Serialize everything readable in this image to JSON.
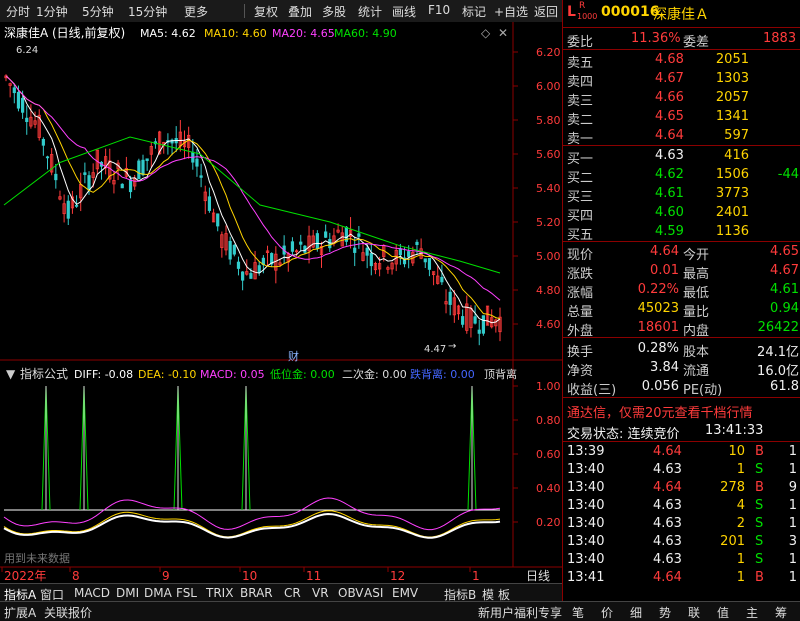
{
  "toolbar": {
    "items": [
      "分时",
      "1分钟",
      "5分钟",
      "15分钟",
      "更多",
      "复权",
      "叠加",
      "多股",
      "统计",
      "画线",
      "F10",
      "标记",
      "+自选",
      "返回"
    ]
  },
  "chart": {
    "stock_title": "深康佳A",
    "mode": "(日线,前复权)",
    "ma5_label": "MA5: 4.62",
    "ma10_label": "MA10: 4.60",
    "ma20_label": "MA20: 4.65",
    "ma60_label": "MA60: 4.90",
    "high_label": "6.24",
    "low_label": "4.47",
    "cai_label": "财",
    "colors": {
      "ma5": "#ffffff",
      "ma10": "#ffd400",
      "ma20": "#ff40ff",
      "ma60": "#00e000",
      "up": "#ff3b3b",
      "down": "#33cccc",
      "axis": "#8b0000"
    },
    "price_ticks": [
      "6.20",
      "6.00",
      "5.80",
      "5.60",
      "5.40",
      "5.20",
      "5.00",
      "4.80",
      "4.60"
    ],
    "date_labels": [
      "2022年",
      "8",
      "9",
      "10",
      "11",
      "12",
      "1"
    ],
    "period_label": "日线"
  },
  "indicator": {
    "name": "指标公式",
    "diff": "DIFF: -0.08",
    "dea": "DEA: -0.10",
    "macd": "MACD: 0.05",
    "low_gold": "低位金: 0.00",
    "second_gold": "二次金: 0.00",
    "div": "跌背离: 0.00",
    "top_div": "顶背离",
    "ticks": [
      "1.00",
      "0.80",
      "0.60",
      "0.40",
      "0.20"
    ],
    "future_note": "用到未来数据"
  },
  "quote": {
    "badge_l": "L",
    "badge_r": "R",
    "badge_num": "1000",
    "code": "000016",
    "name": "深康佳Ａ",
    "weibi_label": "委比",
    "weibi_value": "11.36%",
    "weicha_label": "委差",
    "weicha_value": "1883",
    "sell": [
      {
        "label": "卖五",
        "price": "4.68",
        "vol": "2051"
      },
      {
        "label": "卖四",
        "price": "4.67",
        "vol": "1303"
      },
      {
        "label": "卖三",
        "price": "4.66",
        "vol": "2057"
      },
      {
        "label": "卖二",
        "price": "4.65",
        "vol": "1341"
      },
      {
        "label": "卖一",
        "price": "4.64",
        "vol": "597"
      }
    ],
    "buy": [
      {
        "label": "买一",
        "price": "4.63",
        "vol": "416",
        "extra": ""
      },
      {
        "label": "买二",
        "price": "4.62",
        "vol": "1506",
        "extra": "-44"
      },
      {
        "label": "买三",
        "price": "4.61",
        "vol": "3773",
        "extra": ""
      },
      {
        "label": "买四",
        "price": "4.60",
        "vol": "2401",
        "extra": ""
      },
      {
        "label": "买五",
        "price": "4.59",
        "vol": "1136",
        "extra": ""
      }
    ],
    "stats": [
      {
        "l1": "现价",
        "v1": "4.64",
        "c1": "red",
        "l2": "今开",
        "v2": "4.65",
        "c2": "red"
      },
      {
        "l1": "涨跌",
        "v1": "0.01",
        "c1": "red",
        "l2": "最高",
        "v2": "4.67",
        "c2": "red"
      },
      {
        "l1": "涨幅",
        "v1": "0.22%",
        "c1": "red",
        "l2": "最低",
        "v2": "4.61",
        "c2": "green"
      },
      {
        "l1": "总量",
        "v1": "45023",
        "c1": "yellow",
        "l2": "量比",
        "v2": "0.94",
        "c2": "green"
      },
      {
        "l1": "外盘",
        "v1": "18601",
        "c1": "red",
        "l2": "内盘",
        "v2": "26422",
        "c2": "green"
      }
    ],
    "stats2": [
      {
        "l1": "换手",
        "v1": "0.28%",
        "l2": "股本",
        "v2": "24.1亿"
      },
      {
        "l1": "净资",
        "v1": "3.84",
        "l2": "流通",
        "v2": "16.0亿"
      },
      {
        "l1": "收益(三)",
        "v1": "0.056",
        "l2": "PE(动)",
        "v2": "61.8"
      }
    ],
    "ad_text": "通达信，仅需20元查看千档行情",
    "trade_status_label": "交易状态: 连续竞价",
    "trade_status_time": "13:41:33",
    "ticks": [
      {
        "time": "13:39",
        "price": "4.64",
        "pc": "red",
        "vol": "10",
        "bs": "B",
        "bc": "red",
        "n": "1"
      },
      {
        "time": "13:40",
        "price": "4.63",
        "pc": "white",
        "vol": "1",
        "bs": "S",
        "bc": "green",
        "n": "1"
      },
      {
        "time": "13:40",
        "price": "4.64",
        "pc": "red",
        "vol": "278",
        "bs": "B",
        "bc": "red",
        "n": "9"
      },
      {
        "time": "13:40",
        "price": "4.63",
        "pc": "white",
        "vol": "4",
        "bs": "S",
        "bc": "green",
        "n": "1"
      },
      {
        "time": "13:40",
        "price": "4.63",
        "pc": "white",
        "vol": "2",
        "bs": "S",
        "bc": "green",
        "n": "1"
      },
      {
        "time": "13:40",
        "price": "4.63",
        "pc": "white",
        "vol": "201",
        "bs": "S",
        "bc": "green",
        "n": "3"
      },
      {
        "time": "13:40",
        "price": "4.63",
        "pc": "white",
        "vol": "1",
        "bs": "S",
        "bc": "green",
        "n": "1"
      },
      {
        "time": "13:41",
        "price": "4.64",
        "pc": "red",
        "vol": "1",
        "bs": "B",
        "bc": "red",
        "n": "1"
      }
    ]
  },
  "tabs_row1": [
    "指标A",
    "窗口",
    "MACD",
    "DMI",
    "DMA",
    "FSL",
    "TRIX",
    "BRAR",
    "CR",
    "VR",
    "OBV",
    "ASI",
    "EMV",
    "指标B",
    "模",
    "板"
  ],
  "tabs_row2": [
    "扩展A",
    "关联报价",
    "新用户福利专享"
  ],
  "bottom_right_tabs": [
    "笔",
    "价",
    "细",
    "势",
    "联",
    "值",
    "主",
    "筹"
  ]
}
